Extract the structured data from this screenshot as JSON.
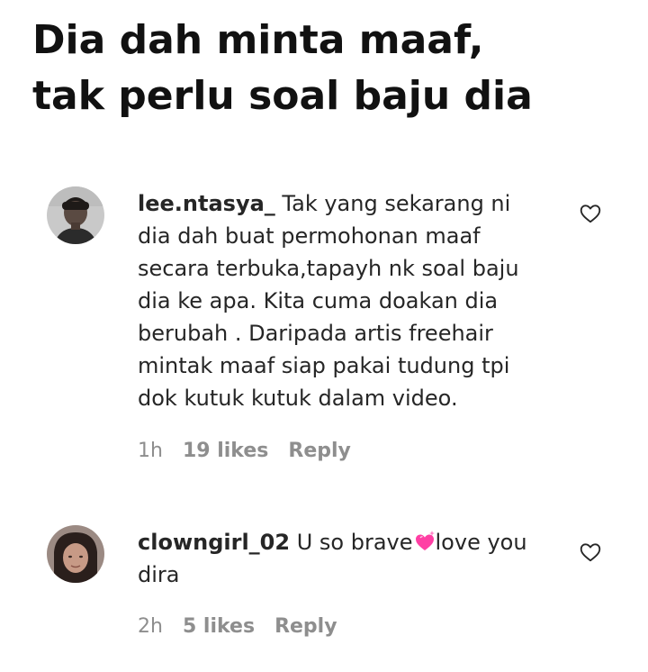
{
  "headline": {
    "line1": "Dia dah minta maaf,",
    "line2": "tak perlu soal baju dia"
  },
  "comments": [
    {
      "username": "lee.ntasya_",
      "text_lines": [
        "Tak yang sekarang ni",
        "dia dah buat permohonan maaf",
        "secara terbuka,tapayh nk soal baju",
        "dia ke apa. Kita cuma doakan dia",
        "berubah . Daripada artis freehair",
        "mintak maaf siap pakai tudung tpi",
        "dok kutuk kutuk dalam video."
      ],
      "time": "1h",
      "likes": "19 likes",
      "reply": "Reply"
    },
    {
      "username": "clowngirl_02",
      "text_before_emoji": "U so brave",
      "emoji": "sparkling-heart-emoji",
      "text_after_emoji": "love you",
      "text_line2": "dira",
      "time": "2h",
      "likes": "5 likes",
      "reply": "Reply"
    }
  ],
  "icons": {
    "like": "heart-outline-icon"
  },
  "colors": {
    "text": "#262626",
    "meta": "#8e8e8e",
    "emoji_heart": "#ff3fa4"
  }
}
